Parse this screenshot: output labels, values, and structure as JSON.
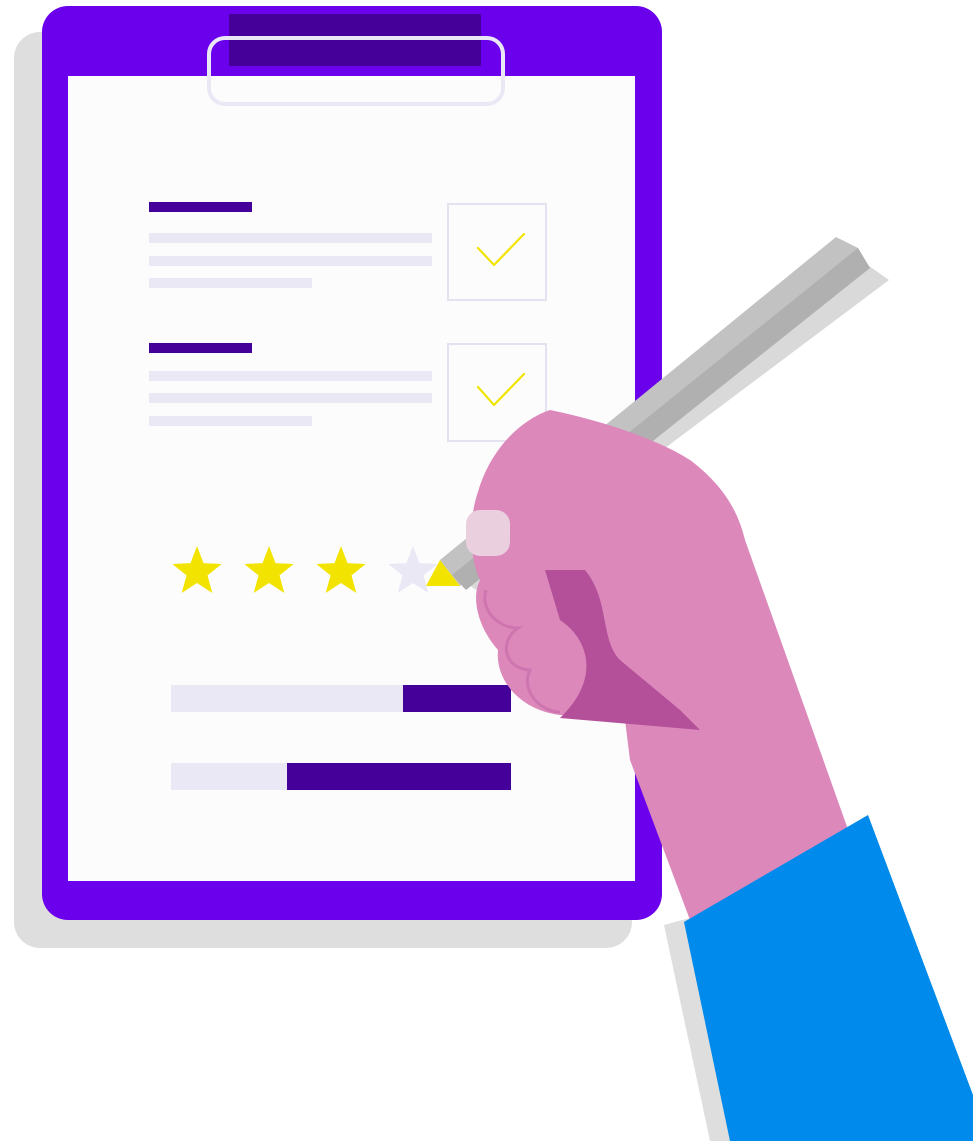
{
  "illustration": {
    "subject": "clipboard-review",
    "colors": {
      "background": "#ffffff",
      "shadow": "#dedede",
      "clipboard": "#6a00ec",
      "clip_bar": "#440099",
      "paper": "#fcfcfd",
      "heading_bar": "#440099",
      "text_line": "#ebe8f5",
      "checkbox_border": "#e4e1f0",
      "checkmark": "#f2e400",
      "star_filled": "#f2e400",
      "star_empty": "#ebe8f5",
      "progress_track": "#ebe8f5",
      "progress_fill": "#440099",
      "skin": "#dc88bb",
      "skin_shadow": "#b4509a",
      "nail": "#ead0df",
      "pencil": "#c0c0c0",
      "pencil_light": "#d8d8d8",
      "pencil_tip": "#f2e400",
      "sleeve": "#008aeb"
    },
    "checklist": {
      "items": [
        {
          "checked": true,
          "icon": "checkmark-icon"
        },
        {
          "checked": true,
          "icon": "checkmark-icon"
        }
      ]
    },
    "rating": {
      "value": 3,
      "max": 4,
      "icon": "star-icon"
    },
    "progress_bars": [
      {
        "track_fraction": 0.68
      },
      {
        "track_fraction": 0.34
      }
    ]
  }
}
